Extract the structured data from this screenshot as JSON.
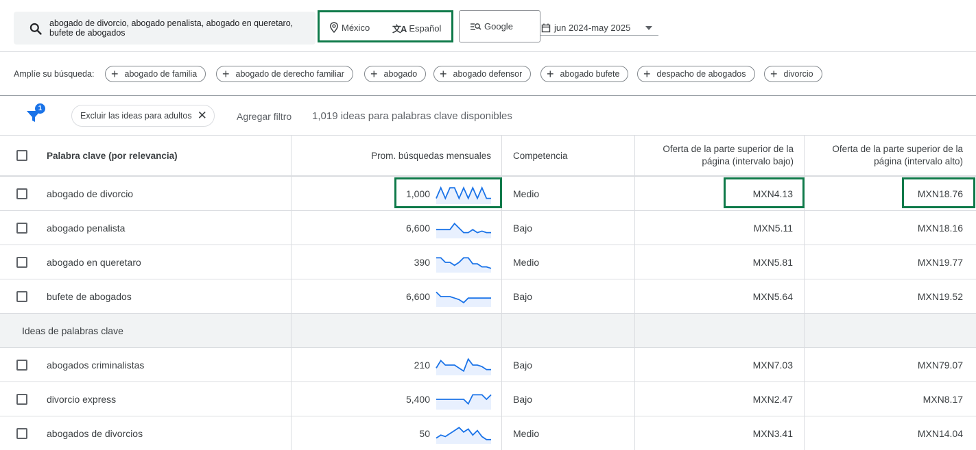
{
  "search": {
    "keywords": "abogado de divorcio, abogado penalista, abogado en queretaro, bufete de abogados",
    "location": "México",
    "language": "Español",
    "network": "Google",
    "date_range": "jun 2024-may 2025"
  },
  "expand": {
    "label": "Amplíe su búsqueda:",
    "chips": [
      "abogado de familia",
      "abogado de derecho familiar",
      "abogado",
      "abogado defensor",
      "abogado bufete",
      "despacho de abogados",
      "divorcio"
    ]
  },
  "filters": {
    "badge": "1",
    "exclude_chip": "Excluir las ideas para adultos",
    "add_filter": "Agregar filtro",
    "ideas_count": "1,019 ideas para palabras clave disponibles"
  },
  "table": {
    "headers": {
      "keyword": "Palabra clave (por relevancia)",
      "searches": "Prom. búsquedas mensuales",
      "competition": "Competencia",
      "bid_low": "Oferta de la parte superior de la página (intervalo bajo)",
      "bid_high": "Oferta de la parte superior de la página (intervalo alto)"
    },
    "provided_rows": [
      {
        "keyword": "abogado de divorcio",
        "searches": "1,000",
        "competition": "Medio",
        "bid_low": "MXN4.13",
        "bid_high": "MXN18.76",
        "trend": [
          2,
          9,
          2,
          9,
          9,
          2,
          9,
          2,
          9,
          2,
          9,
          2,
          2
        ],
        "highlight": true
      },
      {
        "keyword": "abogado penalista",
        "searches": "6,600",
        "competition": "Bajo",
        "bid_low": "MXN5.11",
        "bid_high": "MXN18.16",
        "trend": [
          4,
          4,
          4,
          4,
          8,
          5,
          2,
          2,
          4,
          2,
          3,
          2,
          2
        ],
        "highlight": false
      },
      {
        "keyword": "abogado en queretaro",
        "searches": "390",
        "competition": "Medio",
        "bid_low": "MXN5.81",
        "bid_high": "MXN19.77",
        "trend": [
          8,
          8,
          5,
          5,
          3,
          5,
          8,
          8,
          4,
          4,
          2,
          2,
          1
        ],
        "highlight": false
      },
      {
        "keyword": "bufete de abogados",
        "searches": "6,600",
        "competition": "Bajo",
        "bid_low": "MXN5.64",
        "bid_high": "MXN19.52",
        "trend": [
          8,
          5,
          5,
          5,
          4,
          3,
          1,
          4,
          4,
          4,
          4,
          4,
          4
        ],
        "highlight": false
      }
    ],
    "section_label": "Ideas de palabras clave",
    "idea_rows": [
      {
        "keyword": "abogados criminalistas",
        "searches": "210",
        "competition": "Bajo",
        "bid_low": "MXN7.03",
        "bid_high": "MXN79.07",
        "trend": [
          3,
          8,
          5,
          5,
          5,
          3,
          1,
          9,
          5,
          5,
          4,
          2,
          2
        ]
      },
      {
        "keyword": "divorcio express",
        "searches": "5,400",
        "competition": "Bajo",
        "bid_low": "MXN2.47",
        "bid_high": "MXN8.17",
        "trend": [
          5,
          5,
          5,
          5,
          5,
          5,
          5,
          2,
          8,
          8,
          8,
          5,
          8
        ]
      },
      {
        "keyword": "abogados de divorcios",
        "searches": "50",
        "competition": "Medio",
        "bid_low": "MXN3.41",
        "bid_high": "MXN14.04",
        "trend": [
          2,
          4,
          3,
          5,
          7,
          9,
          6,
          8,
          4,
          7,
          3,
          1,
          1
        ]
      }
    ]
  },
  "colors": {
    "highlight": "#0f7a4a",
    "spark": "#1a73e8",
    "badge": "#1a73e8"
  }
}
